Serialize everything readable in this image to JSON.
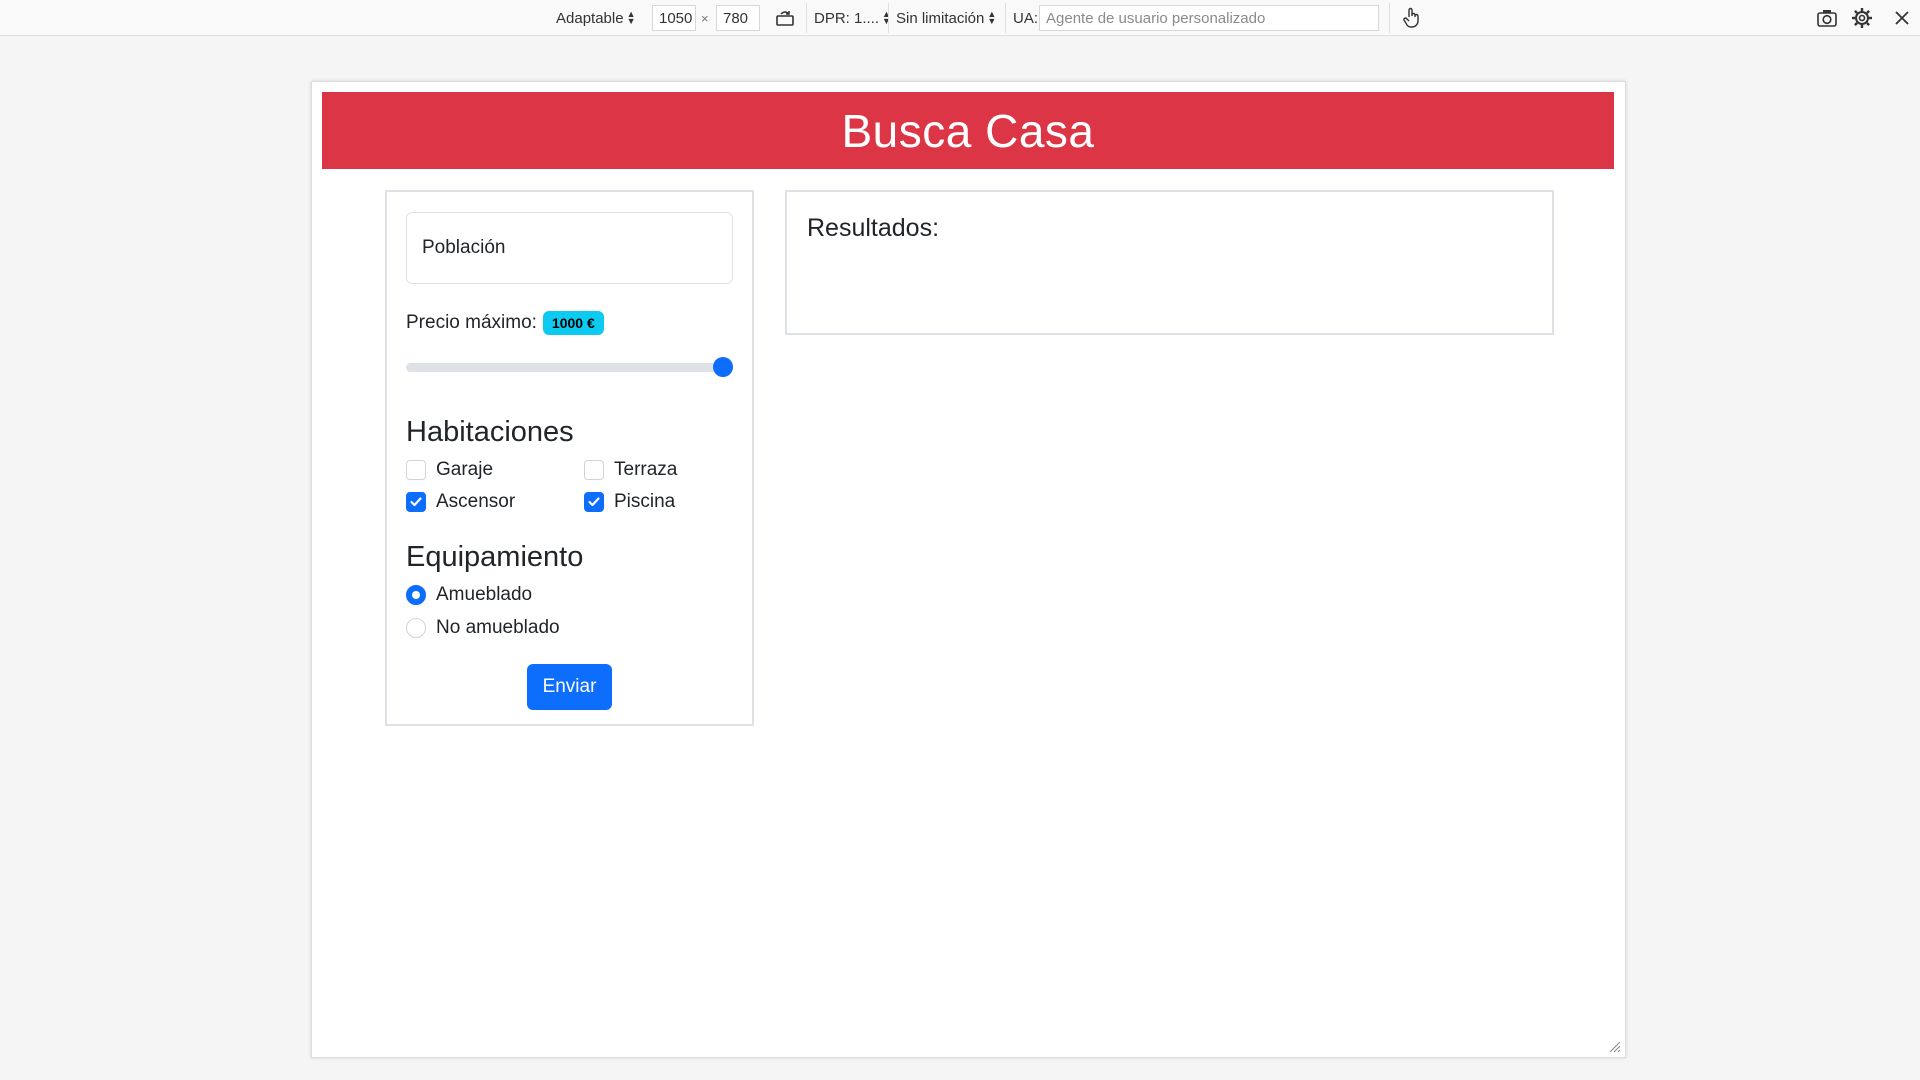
{
  "devtools": {
    "device_mode": "Adaptable",
    "width": "1050",
    "separator": "×",
    "height": "780",
    "dpr": "DPR: 1....",
    "throttling": "Sin limitación",
    "ua_label": "UA:",
    "ua_placeholder": "Agente de usuario personalizado"
  },
  "page": {
    "title": "Busca Casa",
    "accent_color": "#dc3545",
    "primary_color": "#0d6efd"
  },
  "filters": {
    "location_placeholder": "Población",
    "price_label": "Precio máximo:",
    "price_badge": "1000 €",
    "price_slider_fraction": 1.0,
    "rooms_title": "Habitaciones",
    "checkboxes": [
      {
        "label": "Garaje",
        "checked": false
      },
      {
        "label": "Terraza",
        "checked": false
      },
      {
        "label": "Ascensor",
        "checked": true
      },
      {
        "label": "Piscina",
        "checked": true
      }
    ],
    "equipment_title": "Equipamiento",
    "radios": [
      {
        "label": "Amueblado",
        "checked": true
      },
      {
        "label": "No amueblado",
        "checked": false
      }
    ],
    "submit_label": "Enviar"
  },
  "results": {
    "title": "Resultados:"
  }
}
